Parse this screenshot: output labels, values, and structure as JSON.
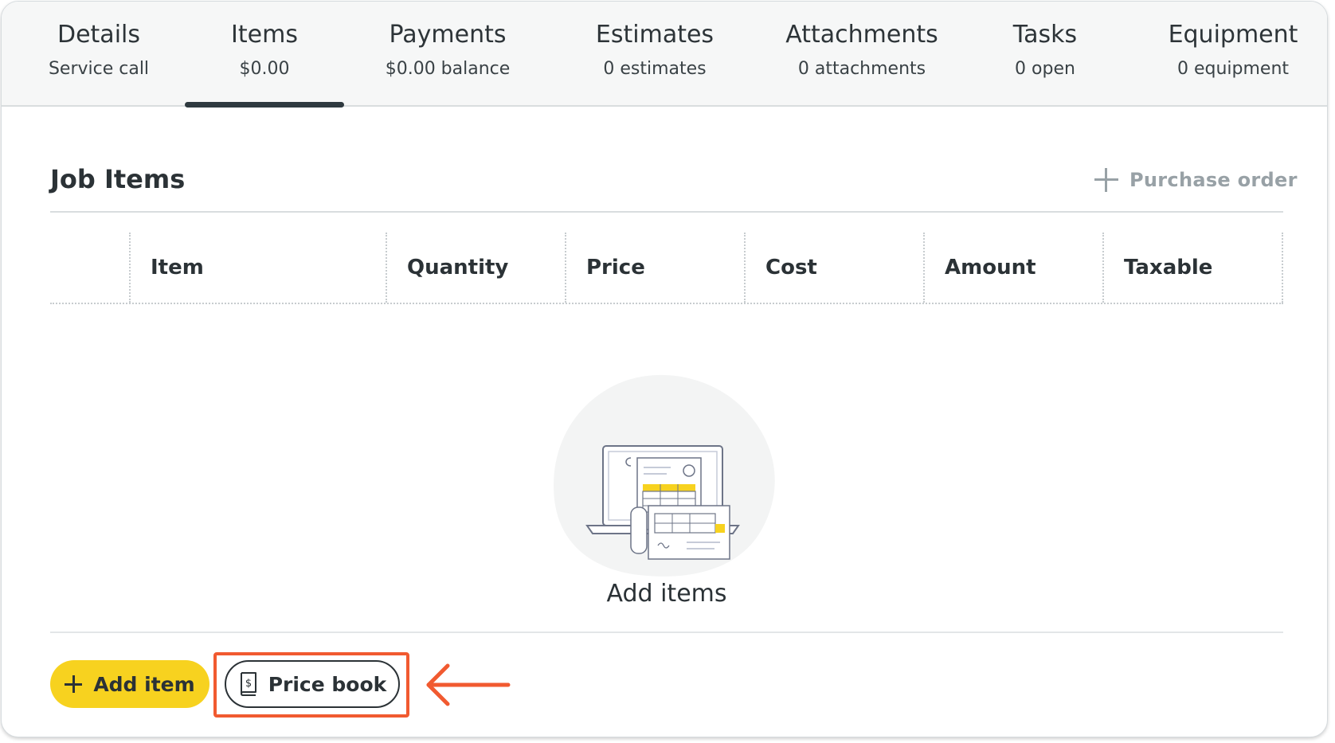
{
  "tabs": [
    {
      "title": "Details",
      "subtitle": "Service call",
      "active": false
    },
    {
      "title": "Items",
      "subtitle": "$0.00",
      "active": true
    },
    {
      "title": "Payments",
      "subtitle": "$0.00 balance",
      "active": false
    },
    {
      "title": "Estimates",
      "subtitle": "0 estimates",
      "active": false
    },
    {
      "title": "Attachments",
      "subtitle": "0 attachments",
      "active": false
    },
    {
      "title": "Tasks",
      "subtitle": "0 open",
      "active": false
    },
    {
      "title": "Equipment",
      "subtitle": "0 equipment",
      "active": false
    }
  ],
  "job_items": {
    "title": "Job Items",
    "purchase_order_label": "Purchase order",
    "columns": [
      "Item",
      "Quantity",
      "Price",
      "Cost",
      "Amount",
      "Taxable"
    ],
    "empty_label": "Add items"
  },
  "actions": {
    "add_item_label": "Add item",
    "price_book_label": "Price book"
  },
  "colors": {
    "accent_yellow": "#f7d21f",
    "highlight_orange": "#f15a30",
    "tab_underline": "#2f3a40",
    "muted_text": "#98a1a6"
  },
  "icons": {
    "purchase_order": "plus-icon",
    "add_item": "plus-icon",
    "price_book": "price-book-icon",
    "empty_state": "invoice-illustration-icon",
    "callout": "arrow-left-icon"
  }
}
